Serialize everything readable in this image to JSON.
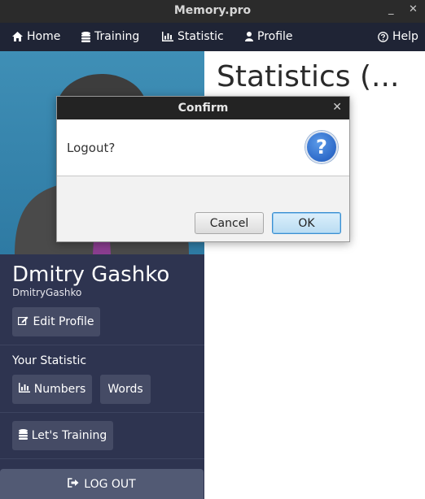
{
  "window": {
    "title": "Memory.pro",
    "minimize_glyph": "_",
    "close_glyph": "✕"
  },
  "nav": {
    "items": [
      {
        "label": "Home",
        "icon": "home-icon"
      },
      {
        "label": "Training",
        "icon": "database-icon"
      },
      {
        "label": "Statistic",
        "icon": "bar-chart-icon"
      },
      {
        "label": "Profile",
        "icon": "user-icon"
      },
      {
        "label": "Help",
        "icon": "question-circle-icon"
      }
    ]
  },
  "sidebar": {
    "name": "Dmitry Gashko",
    "username": "DmitryGashko",
    "edit_profile_label": "Edit Profile",
    "statistic_section_label": "Your Statistic",
    "numbers_label": "Numbers",
    "words_label": "Words",
    "training_label": "Let's Training",
    "logout_label": "LOG OUT"
  },
  "main": {
    "title": "Statistics (..."
  },
  "dialog": {
    "title": "Confirm",
    "close_glyph": "✕",
    "message": "Logout?",
    "icon_glyph": "?",
    "cancel_label": "Cancel",
    "ok_label": "OK"
  },
  "colors": {
    "nav_bg": "#1f2435",
    "sidebar_bg": "#2e3450",
    "sidebar_button_bg": "#454b65",
    "avatar_bg": "#3f8fb6",
    "ok_border": "#3a8fd1"
  }
}
